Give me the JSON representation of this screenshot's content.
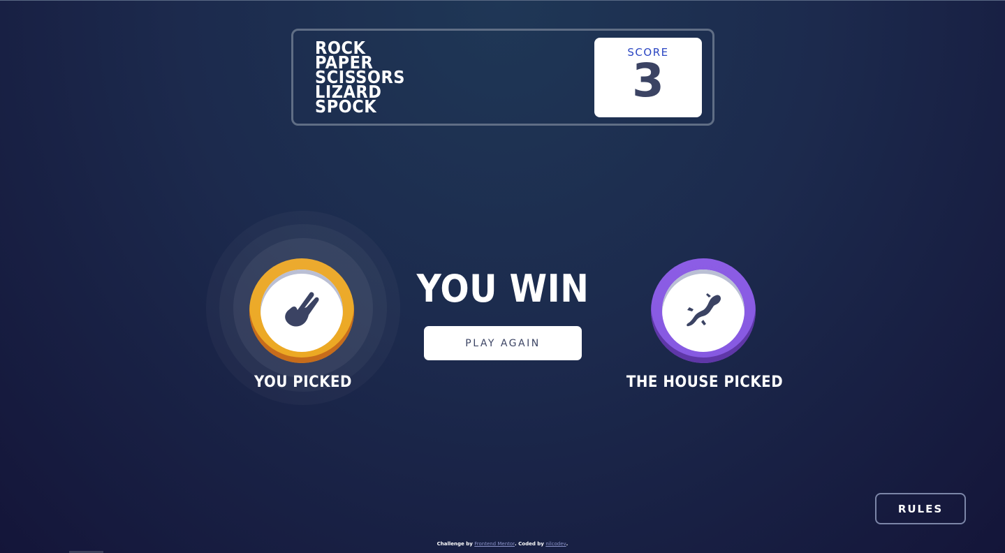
{
  "header": {
    "title_lines": [
      "ROCK",
      "PAPER",
      "SCISSORS",
      "LIZARD",
      "SPOCK"
    ],
    "score_label": "SCORE",
    "score_value": "3"
  },
  "player": {
    "label": "YOU PICKED",
    "choice_icon": "scissors-icon",
    "ring_color": "#eca922"
  },
  "house": {
    "label": "THE HOUSE PICKED",
    "choice_icon": "lizard-icon",
    "ring_color": "#8659e1"
  },
  "result": {
    "text": "YOU WIN",
    "play_again_label": "PLAY AGAIN"
  },
  "rules_button_label": "RULES",
  "footer": {
    "prefix": "Challenge by",
    "link1": "Frontend Mentor",
    "middle": ". Coded by",
    "link2": "nilcodev",
    "suffix": "."
  },
  "colors": {
    "background_top": "#1f3756",
    "background_bottom": "#141539",
    "score_label": "#2a45c2",
    "dark_text": "#3b4363"
  }
}
